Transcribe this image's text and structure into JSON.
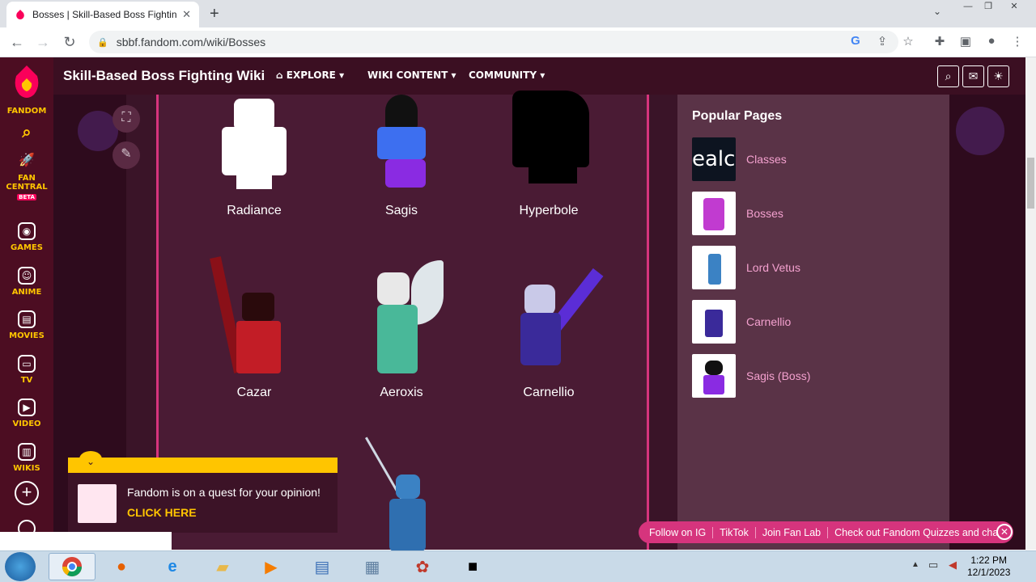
{
  "browser": {
    "tab_title": "Bosses | Skill-Based Boss Fighting",
    "url": "sbbf.fandom.com/wiki/Bosses"
  },
  "rail": {
    "fandom": "FANDOM",
    "fan_central": "FAN CENTRAL",
    "beta": "BETA",
    "games": "GAMES",
    "anime": "ANIME",
    "movies": "MOVIES",
    "tv": "TV",
    "video": "VIDEO",
    "wikis": "WIKIS"
  },
  "header": {
    "wiki_name": "Skill-Based Boss Fighting Wiki",
    "nav": [
      "EXPLORE",
      "WIKI CONTENT",
      "COMMUNITY"
    ]
  },
  "bosses": [
    {
      "name": "Radiance",
      "color": "#ffffff"
    },
    {
      "name": "Sagis",
      "color": "#3d6ff0"
    },
    {
      "name": "Hyperbole",
      "color": "#000000"
    },
    {
      "name": "Cazar",
      "color": "#c21d26"
    },
    {
      "name": "Aeroxis",
      "color": "#49b899"
    },
    {
      "name": "Carnellio",
      "color": "#3a2a9a"
    }
  ],
  "sidebar": {
    "title": "Popular Pages",
    "items": [
      "Classes",
      "Bosses",
      "Lord Vetus",
      "Carnellio",
      "Sagis (Boss)"
    ],
    "thumb_text": "ealc"
  },
  "survey": {
    "text": "Fandom is on a quest for your opinion!",
    "cta": "CLICK HERE"
  },
  "banner": {
    "items": [
      "Follow on IG",
      "TikTok",
      "Join Fan Lab",
      "Check out Fandom Quizzes and cha"
    ]
  },
  "taskbar": {
    "time": "1:22 PM",
    "date": "12/1/2023"
  }
}
